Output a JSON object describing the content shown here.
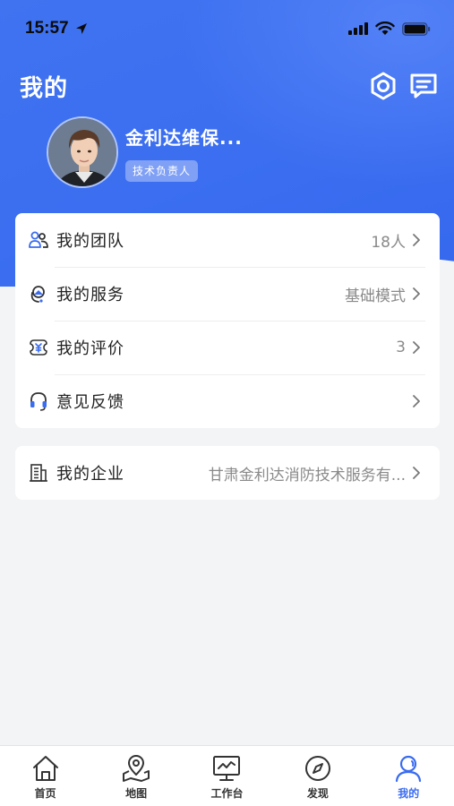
{
  "status_bar": {
    "time": "15:57"
  },
  "header": {
    "title": "我的"
  },
  "profile": {
    "name": "金利达维保...",
    "role": "技术负责人"
  },
  "menu": [
    {
      "label": "我的团队",
      "value": "18人",
      "icon": "team-icon"
    },
    {
      "label": "我的服务",
      "value": "基础模式",
      "icon": "service-icon"
    },
    {
      "label": "我的评价",
      "value": "3",
      "icon": "rating-icon"
    },
    {
      "label": "意见反馈",
      "value": "",
      "icon": "headset-icon"
    }
  ],
  "company": {
    "label": "我的企业",
    "value": "甘肃金利达消防技术服务有...",
    "icon": "building-icon"
  },
  "tabbar": [
    {
      "label": "首页",
      "icon": "home-icon"
    },
    {
      "label": "地图",
      "icon": "map-pin-icon"
    },
    {
      "label": "工作台",
      "icon": "monitor-icon"
    },
    {
      "label": "发现",
      "icon": "compass-icon"
    },
    {
      "label": "我的",
      "icon": "person-icon",
      "active": true
    }
  ],
  "colors": {
    "primary": "#3a6cf0",
    "background": "#f3f4f6"
  }
}
